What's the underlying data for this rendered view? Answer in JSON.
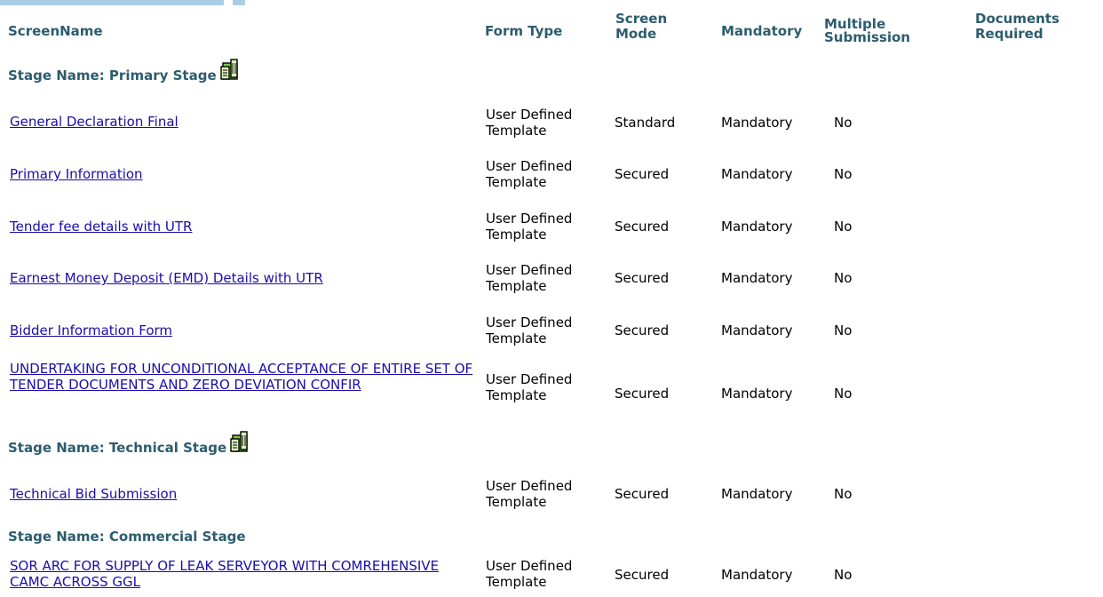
{
  "headers": {
    "screen_name": "ScreenName",
    "form_type": "Form Type",
    "screen_mode": "Screen\nMode",
    "mandatory": "Mandatory",
    "multiple_submission": "Multiple\nSubmission",
    "documents_required": "Documents\nRequired"
  },
  "stages": {
    "primary": "Stage Name: Primary Stage",
    "technical": "Stage Name: Technical Stage",
    "commercial": "Stage Name: Commercial Stage"
  },
  "rows": [
    {
      "name": "General Declaration Final",
      "form_type": "User Defined\nTemplate",
      "mode": "Standard",
      "mandatory": "Mandatory",
      "multiple": "No"
    },
    {
      "name": "Primary Information",
      "form_type": "User Defined\nTemplate",
      "mode": "Secured",
      "mandatory": "Mandatory",
      "multiple": "No"
    },
    {
      "name": "Tender fee details with UTR",
      "form_type": "User Defined\nTemplate",
      "mode": "Secured",
      "mandatory": "Mandatory",
      "multiple": "No"
    },
    {
      "name": "Earnest Money Deposit (EMD) Details with UTR",
      "form_type": "User Defined\nTemplate",
      "mode": "Secured",
      "mandatory": "Mandatory",
      "multiple": "No"
    },
    {
      "name": "Bidder Information Form",
      "form_type": "User Defined\nTemplate",
      "mode": "Secured",
      "mandatory": "Mandatory",
      "multiple": "No"
    },
    {
      "name": "UNDERTAKING FOR UNCONDITIONAL ACCEPTANCE OF ENTIRE SET OF TENDER DOCUMENTS AND ZERO DEVIATION CONFIR",
      "form_type": "User Defined\nTemplate",
      "mode": "Secured",
      "mandatory": "Mandatory",
      "multiple": "No"
    },
    {
      "name": "Technical Bid Submission",
      "form_type": "User Defined\nTemplate",
      "mode": "Secured",
      "mandatory": "Mandatory",
      "multiple": "No"
    },
    {
      "name": "SOR ARC FOR SUPPLY OF LEAK SERVEYOR WITH COMREHENSIVE CAMC ACROSS GGL",
      "form_type": "User Defined\nTemplate",
      "mode": "Secured",
      "mandatory": "Mandatory",
      "multiple": "No"
    }
  ],
  "icons": {
    "stage_icon": "folder-documents-icon"
  },
  "colors": {
    "header_text": "#2c5c6e",
    "link": "#1a0dab",
    "top_bar": "#a9cde6"
  }
}
